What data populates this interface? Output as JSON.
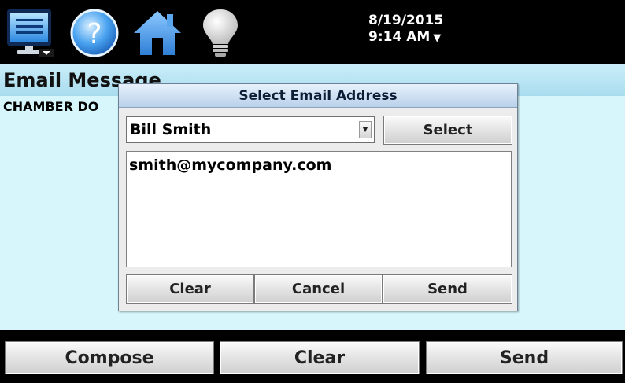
{
  "topbar": {
    "icons": [
      "monitor-menu-icon",
      "help-icon",
      "home-icon",
      "lightbulb-icon"
    ],
    "date": "8/19/2015",
    "time": "9:14 AM",
    "time_arrow": "▼"
  },
  "screen": {
    "title": "Email Message",
    "message_text": "CHAMBER DO"
  },
  "dialog": {
    "title": "Select Email Address",
    "recipient_selected": "Bill Smith",
    "select_label": "Select",
    "address": "smith@mycompany.com",
    "clear_label": "Clear",
    "cancel_label": "Cancel",
    "send_label": "Send"
  },
  "bottombar": {
    "compose_label": "Compose",
    "clear_label": "Clear",
    "send_label": "Send"
  },
  "colors": {
    "screen_bg": "#d6f6fb",
    "title_bar": "#b5e3f2",
    "dialog_title": "#c9dcef",
    "icon_blue": "#2a86e0",
    "house_blue": "#2f7fd6"
  }
}
